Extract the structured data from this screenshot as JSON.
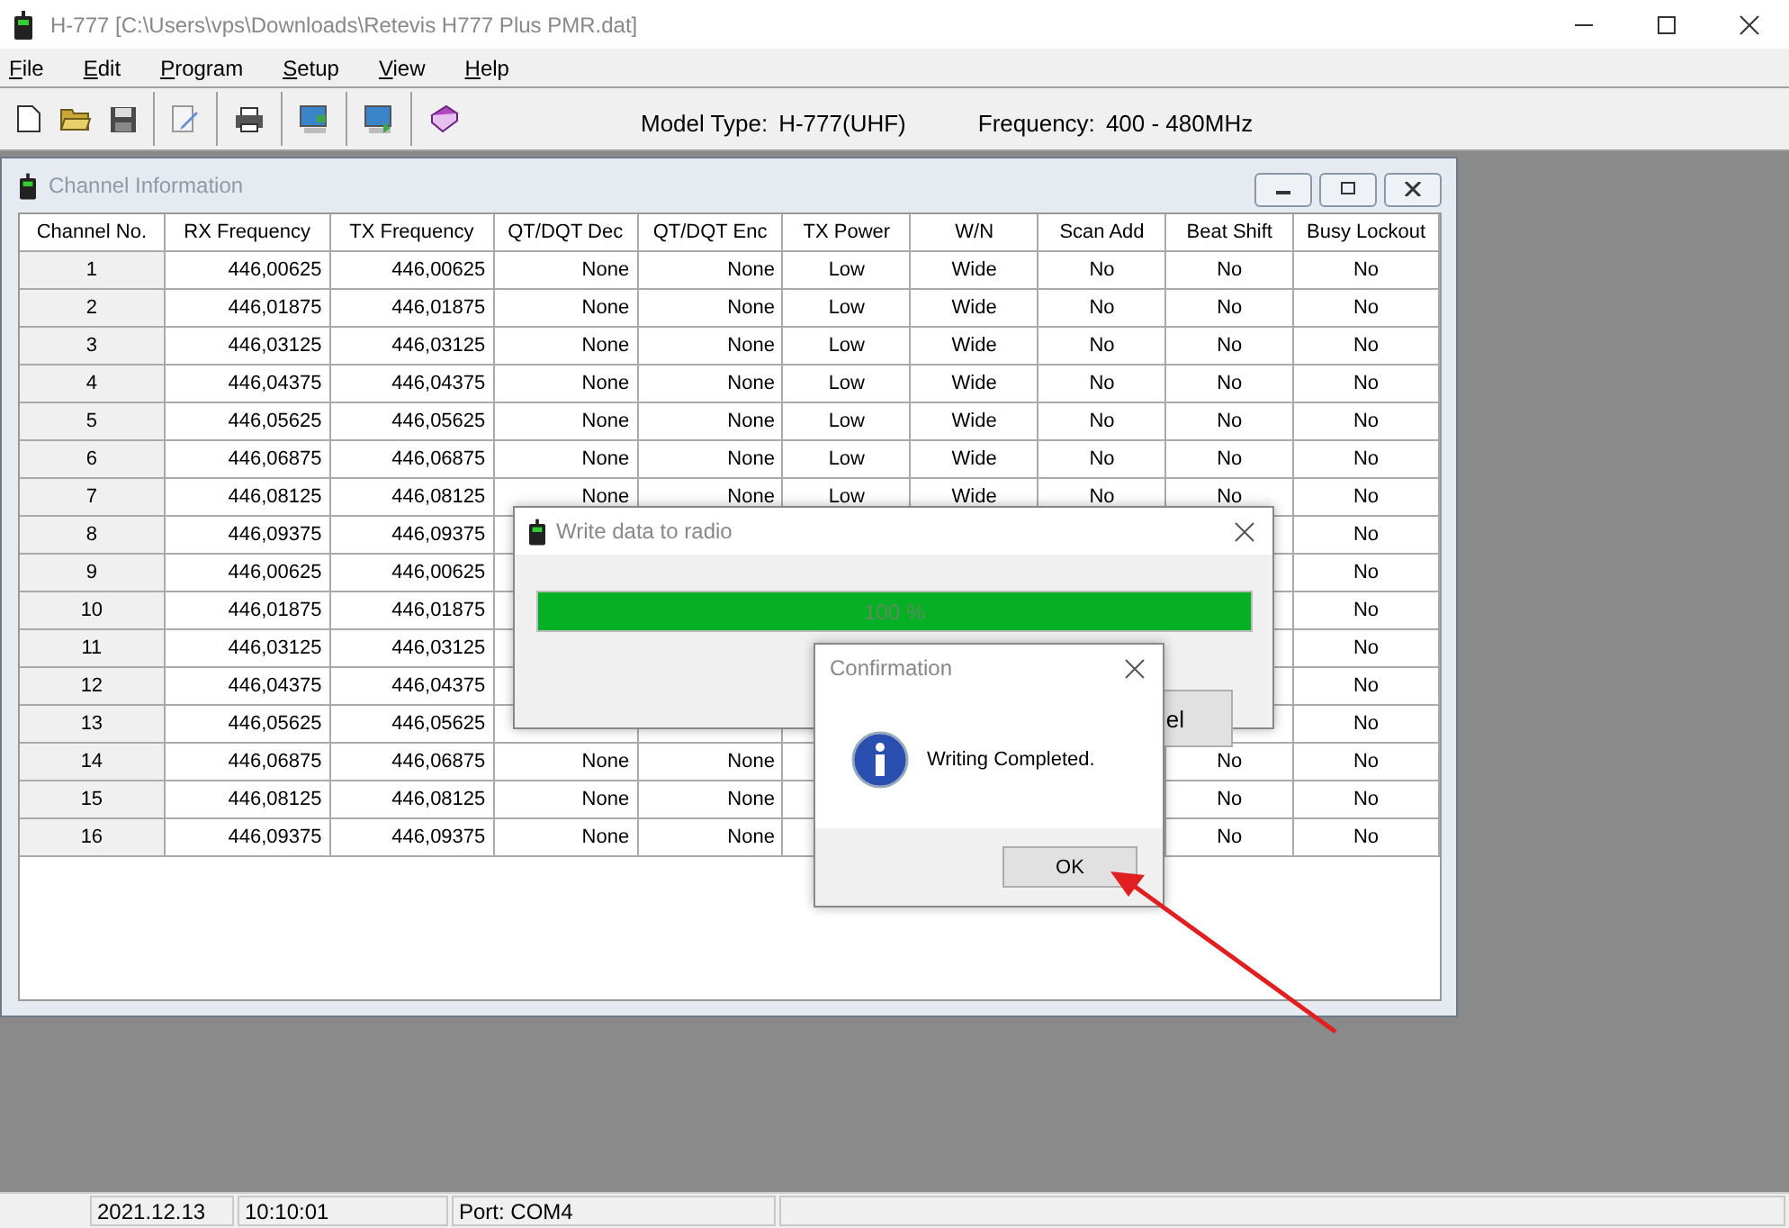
{
  "window": {
    "title": "H-777 [C:\\Users\\vps\\Downloads\\Retevis H777 Plus PMR.dat]"
  },
  "menu": [
    {
      "label": "File"
    },
    {
      "label": "Edit"
    },
    {
      "label": "Program"
    },
    {
      "label": "Setup"
    },
    {
      "label": "View"
    },
    {
      "label": "Help"
    }
  ],
  "toolbar": {
    "model_label": "Model Type:",
    "model": "H-777(UHF)",
    "frequency_label": "Frequency:",
    "frequency": "400 - 480MHz"
  },
  "channel_window": {
    "title": "Channel Information",
    "columns": [
      "Channel No.",
      "RX Frequency",
      "TX Frequency",
      "QT/DQT Dec",
      "QT/DQT Enc",
      "TX Power",
      "W/N",
      "Scan Add",
      "Beat Shift",
      "Busy Lockout"
    ],
    "rows": [
      [
        "1",
        "446,00625",
        "446,00625",
        "None",
        "None",
        "Low",
        "Wide",
        "No",
        "No",
        "No"
      ],
      [
        "2",
        "446,01875",
        "446,01875",
        "None",
        "None",
        "Low",
        "Wide",
        "No",
        "No",
        "No"
      ],
      [
        "3",
        "446,03125",
        "446,03125",
        "None",
        "None",
        "Low",
        "Wide",
        "No",
        "No",
        "No"
      ],
      [
        "4",
        "446,04375",
        "446,04375",
        "None",
        "None",
        "Low",
        "Wide",
        "No",
        "No",
        "No"
      ],
      [
        "5",
        "446,05625",
        "446,05625",
        "None",
        "None",
        "Low",
        "Wide",
        "No",
        "No",
        "No"
      ],
      [
        "6",
        "446,06875",
        "446,06875",
        "None",
        "None",
        "Low",
        "Wide",
        "No",
        "No",
        "No"
      ],
      [
        "7",
        "446,08125",
        "446,08125",
        "None",
        "None",
        "Low",
        "Wide",
        "No",
        "No",
        "No"
      ],
      [
        "8",
        "446,09375",
        "446,09375",
        null,
        null,
        null,
        null,
        null,
        null,
        "No"
      ],
      [
        "9",
        "446,00625",
        "446,00625",
        null,
        null,
        null,
        null,
        null,
        null,
        "No"
      ],
      [
        "10",
        "446,01875",
        "446,01875",
        null,
        null,
        null,
        null,
        null,
        null,
        "No"
      ],
      [
        "11",
        "446,03125",
        "446,03125",
        null,
        null,
        null,
        null,
        null,
        null,
        "No"
      ],
      [
        "12",
        "446,04375",
        "446,04375",
        null,
        null,
        null,
        null,
        null,
        null,
        "No"
      ],
      [
        "13",
        "446,05625",
        "446,05625",
        null,
        null,
        null,
        null,
        null,
        null,
        "No"
      ],
      [
        "14",
        "446,06875",
        "446,06875",
        "None",
        "None",
        null,
        null,
        null,
        "No",
        "No"
      ],
      [
        "15",
        "446,08125",
        "446,08125",
        "None",
        "None",
        null,
        null,
        null,
        "No",
        "No"
      ],
      [
        "16",
        "446,09375",
        "446,09375",
        "None",
        "None",
        null,
        null,
        null,
        "No",
        "No"
      ]
    ]
  },
  "write_dialog": {
    "title": "Write data to radio",
    "level": 1,
    "progress_text": "100 %",
    "button": "el"
  },
  "confirmation": {
    "title": "Confirmation",
    "message": "Writing Completed.",
    "button": "OK"
  },
  "status_bar": [
    "2021.12.13",
    "10:10:01",
    "Port: COM4"
  ]
}
